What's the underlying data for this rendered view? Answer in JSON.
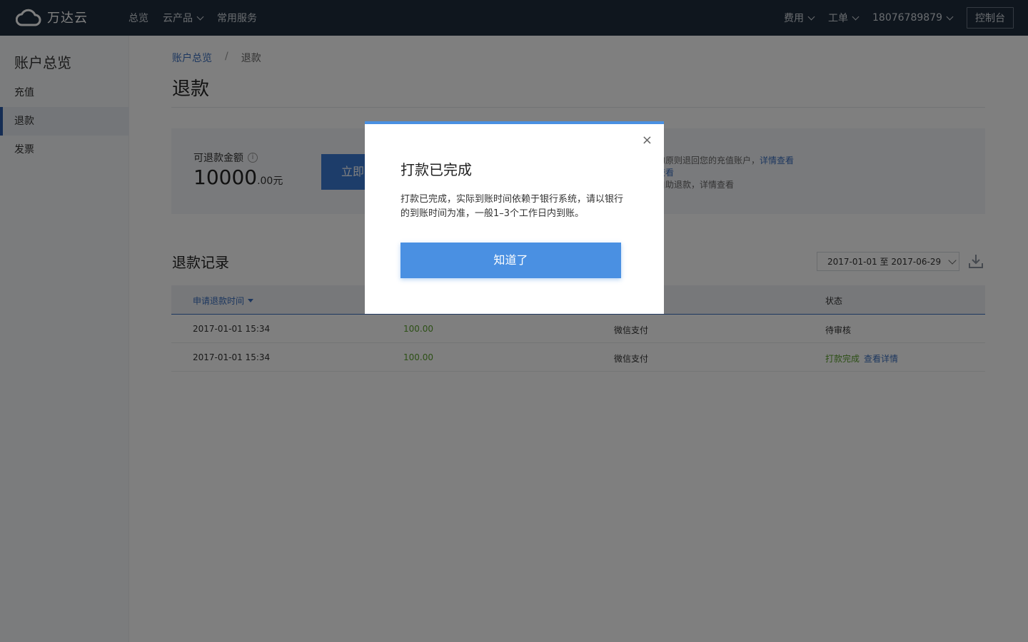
{
  "brand": {
    "name": "万达云",
    "icon": "cloud-icon"
  },
  "topnav": {
    "items": [
      {
        "label": "总览",
        "has_dropdown": false
      },
      {
        "label": "云产品",
        "has_dropdown": true
      },
      {
        "label": "常用服务",
        "has_dropdown": false
      }
    ],
    "right": {
      "fee": "费用",
      "ticket": "工单",
      "account": "18076789879",
      "console": "控制台"
    }
  },
  "sidebar": {
    "title": "账户总览",
    "items": [
      {
        "label": "充值",
        "active": false
      },
      {
        "label": "退款",
        "active": true
      },
      {
        "label": "发票",
        "active": false
      }
    ]
  },
  "breadcrumb": {
    "parent": "账户总览",
    "separator": "/",
    "current": "退款"
  },
  "page_title": "退款",
  "refund_summary": {
    "label": "可退款金额",
    "amount_int": "10000",
    "amount_dec": ".00元",
    "button_label": "立即",
    "notes": {
      "line1_text": "的原则退回您的充值账户，",
      "line1_link": "详情查看",
      "line2_link": "查看",
      "line3_text": "自助退款，详情查看"
    }
  },
  "records": {
    "title": "退款记录",
    "date_range": "2017-01-01 至 2017-06-29",
    "columns": {
      "time": "申请退款时间",
      "status": "状态"
    },
    "rows": [
      {
        "time": "2017-01-01 15:34",
        "amount": "100.00",
        "method": "微信支付",
        "status": "待审核",
        "detail": ""
      },
      {
        "time": "2017-01-01 15:34",
        "amount": "100.00",
        "method": "微信支付",
        "status": "打款完成",
        "detail": "查看详情"
      }
    ]
  },
  "modal": {
    "title": "打款已完成",
    "body": "打款已完成，实际到账时间依赖于银行系统，请以银行的到账时间为准，一般1–3个工作日内到账。",
    "confirm": "知道了",
    "close": "×"
  },
  "colors": {
    "topbar_bg": "#1f2d3d",
    "accent": "#4a90e2",
    "link": "#3a6fbe",
    "money_green": "#5aa02c"
  }
}
